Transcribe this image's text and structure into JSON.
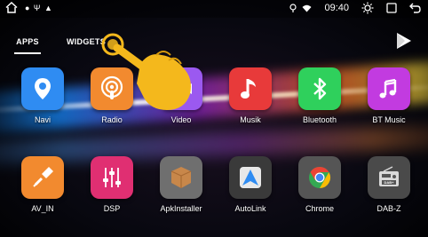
{
  "status_bar": {
    "indicators": "● Ψ ▲",
    "time": "09:40"
  },
  "tabs": [
    {
      "label": "APPS"
    },
    {
      "label": "WIDGETS"
    }
  ],
  "apps": [
    {
      "label": "Navi",
      "icon": "location-pin-icon",
      "color": "#2f8cf2"
    },
    {
      "label": "Radio",
      "icon": "podcast-icon",
      "color": "#f28a2f"
    },
    {
      "label": "Video",
      "icon": "video-icon",
      "color": "#9b59f0"
    },
    {
      "label": "Musik",
      "icon": "music-note-icon",
      "color": "#e83a3a"
    },
    {
      "label": "Bluetooth",
      "icon": "bluetooth-icon",
      "color": "#2fd05c"
    },
    {
      "label": "BT Music",
      "icon": "bt-music-icon",
      "color": "#c23be0"
    },
    {
      "label": "AV_IN",
      "icon": "rca-plug-icon",
      "color": "#f28a2f"
    },
    {
      "label": "DSP",
      "icon": "equalizer-icon",
      "color": "#e02f72"
    },
    {
      "label": "ApkInstaller",
      "icon": "package-box-icon",
      "color": "#6f6f6f"
    },
    {
      "label": "AutoLink",
      "icon": "autolink-icon",
      "color": "#3a3a3a"
    },
    {
      "label": "Chrome",
      "icon": "chrome-icon",
      "color": "#555555"
    },
    {
      "label": "DAB-Z",
      "icon": "dab-radio-icon",
      "color": "#4a4a4a"
    }
  ],
  "colors": {
    "hand": "#f4b81c",
    "text": "#ffffff"
  }
}
